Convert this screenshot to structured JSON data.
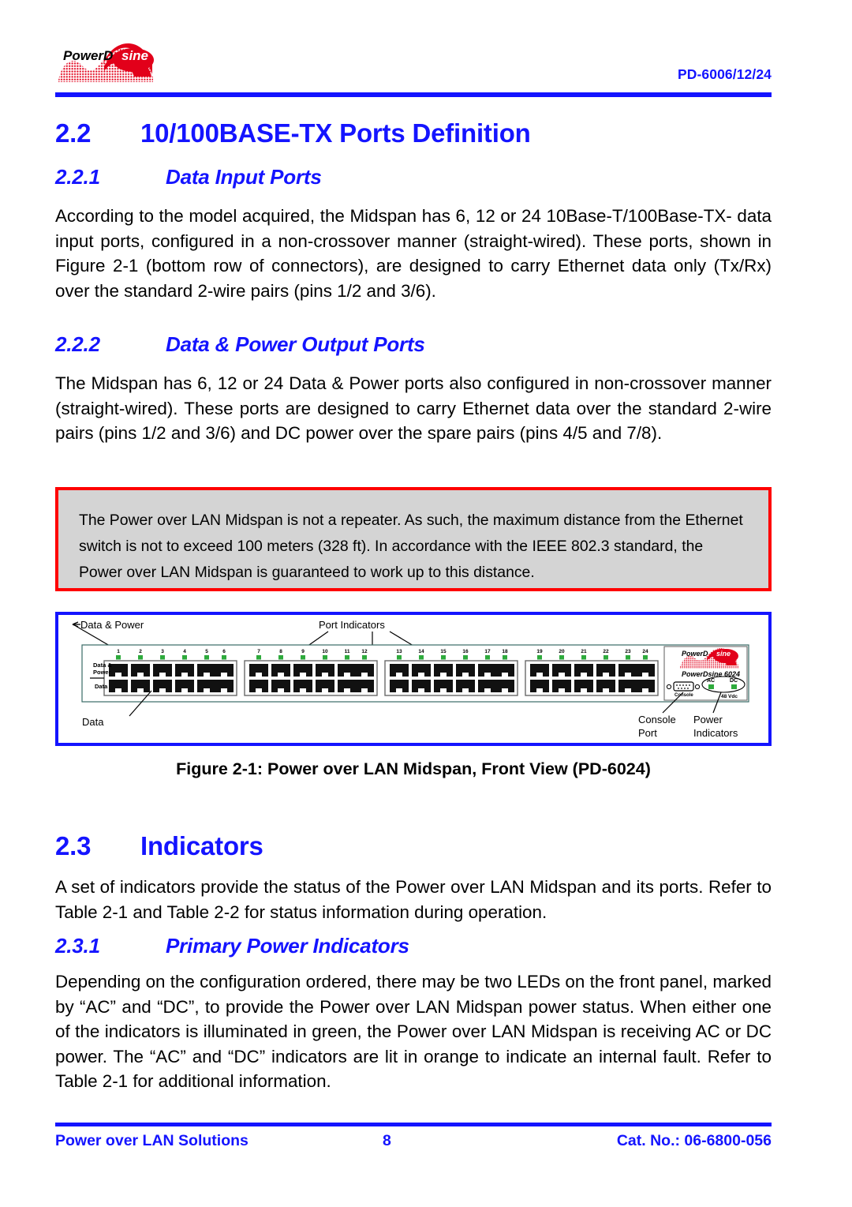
{
  "header": {
    "logo_main": "PowerD",
    "logo_accent": "sine",
    "logo_name": "powerdsine-logo",
    "doc_number": "PD-6006/12/24"
  },
  "sections": {
    "s22": {
      "number": "2.2",
      "title": "10/100BASE-TX Ports Definition"
    },
    "s221": {
      "number": "2.2.1",
      "title": "Data Input Ports",
      "body": "According to the model acquired, the Midspan has 6, 12 or 24 10Base-T/100Base-TX- data input ports, configured in a non-crossover manner (straight-wired). These ports, shown in Figure 2-1 (bottom row of connectors), are designed to carry Ethernet data only (Tx/Rx) over the standard 2-wire pairs (pins 1/2 and 3/6)."
    },
    "s222": {
      "number": "2.2.2",
      "title": "Data & Power Output Ports",
      "body": "The Midspan has 6, 12 or 24 Data & Power ports also configured in non-crossover manner (straight-wired). These ports are designed to carry Ethernet data over the standard 2-wire pairs (pins 1/2 and 3/6) and DC power over the spare pairs (pins 4/5 and 7/8)."
    },
    "s23": {
      "number": "2.3",
      "title": "Indicators",
      "body": "A set of indicators provide the status of the Power over LAN Midspan and its ports. Refer to Table 2-1 and Table 2-2 for status information during operation."
    },
    "s231": {
      "number": "2.3.1",
      "title": "Primary Power Indicators",
      "body": "Depending on the configuration ordered, there may be two LEDs on the front panel, marked by “AC” and “DC”, to provide the Power over LAN Midspan power status. When either one of the indicators is illuminated in green, the Power over LAN Midspan is receiving AC or DC power. The “AC” and “DC” indicators are lit in orange to indicate an internal fault. Refer to Table 2-1 for additional information."
    }
  },
  "note": {
    "text": "The Power over LAN Midspan is not a repeater. As such, the maximum distance from the Ethernet switch is not to exceed 100 meters (328 ft). In accordance with the IEEE 802.3 standard, the Power over LAN Midspan is guaranteed to work up to this distance.",
    "border_color": "#ff0000",
    "fill_color": "#d4d4d4"
  },
  "figure": {
    "caption": "Figure 2-1: Power over LAN Midspan, Front View (PD-6024)",
    "border_color": "#1414ff",
    "callouts": {
      "data_power": "Data & Power",
      "port_indicators": "Port Indicators",
      "data": "Data",
      "console_port_line1": "Console",
      "console_port_line2": "Port",
      "power_indicators_line1": "Power",
      "power_indicators_line2": "Indicators"
    },
    "panel": {
      "row_label_top_line1": "Data &",
      "row_label_top_line2": "Power",
      "row_label_bottom": "Data",
      "brand_logo_main": "PowerD",
      "brand_logo_accent": "sine",
      "model": "PowerDsine 6024",
      "console_label": "Console",
      "led_ac": "AC",
      "led_dc": "DC",
      "voltage": "48 Vdc",
      "port_numbers": [
        1,
        2,
        3,
        4,
        5,
        6,
        7,
        8,
        9,
        10,
        11,
        12,
        13,
        14,
        15,
        16,
        17,
        18,
        19,
        20,
        21,
        22,
        23,
        24
      ],
      "port_group_size": 6,
      "port_group_count": 4,
      "led_color": "#2eaa3c",
      "connector_color": "#111111"
    }
  },
  "footer": {
    "left": "Power over LAN Solutions",
    "page_number": "8",
    "right": "Cat. No.: 06-6800-056",
    "color": "#1414ff"
  },
  "theme": {
    "heading_blue": "#1414ff",
    "logo_red": "#e2001a",
    "body_black": "#000000"
  }
}
